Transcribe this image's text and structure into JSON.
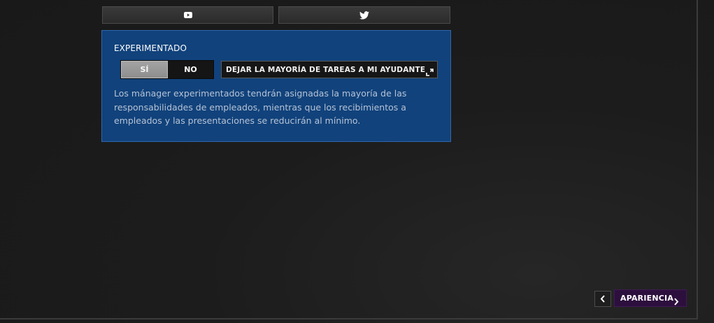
{
  "social": {
    "youtube_icon": "youtube-icon",
    "twitter_icon": "twitter-icon"
  },
  "setting": {
    "title": "EXPERIMENTADO",
    "toggle_yes": "SÍ",
    "toggle_no": "NO",
    "toggle_selected": "SÍ",
    "assistant_option": "DEJAR LA MAYORÍA DE TAREAS A MI AYUDANTE",
    "description": "Los mánager experimentados tendrán asignadas la mayoría de las responsabilidades de empleados, mientras que los recibimientos a empleados y las presentaciones se reducirán al mínimo."
  },
  "navigation": {
    "next_label": "APARIENCIA"
  },
  "colors": {
    "panel_bg": "#11427b",
    "panel_border": "#2f67ad",
    "next_button_bg": "#2d0f3e",
    "background": "#1c1c1c"
  }
}
